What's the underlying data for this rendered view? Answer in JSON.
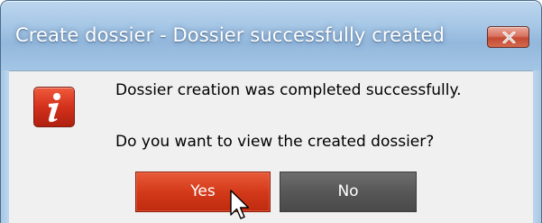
{
  "window": {
    "title": "Create dossier - Dossier successfully created",
    "close_icon": "close-x-icon",
    "title_color": "#ffffff",
    "frame_color": "#a6c7e6"
  },
  "dialog": {
    "icon": "info-icon",
    "icon_color": "#d3311c",
    "message_line1": "Dossier creation was completed successfully.",
    "message_line2": "Do you want to view the created dossier?"
  },
  "buttons": {
    "yes_label": "Yes",
    "no_label": "No",
    "yes_color": "#d33a1a",
    "no_color": "#575757"
  },
  "cursor": {
    "icon": "arrow-pointer-icon"
  }
}
